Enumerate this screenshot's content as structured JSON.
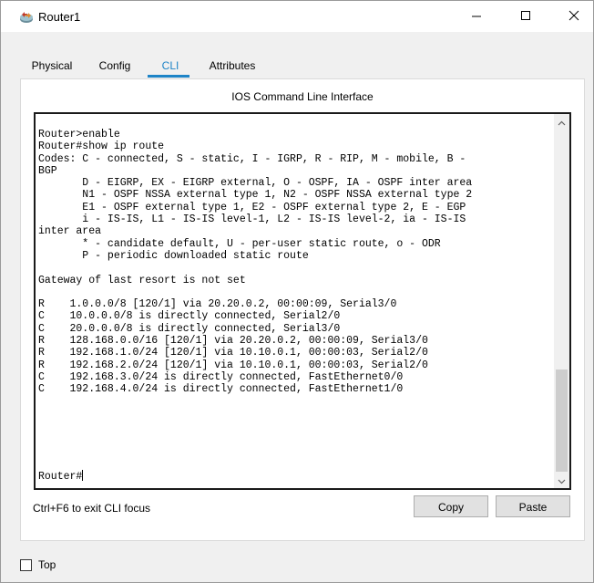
{
  "window": {
    "title": "Router1",
    "minimize_icon": "minimize-icon",
    "maximize_icon": "maximize-icon",
    "close_icon": "close-icon"
  },
  "tabs": [
    {
      "label": "Physical",
      "active": false
    },
    {
      "label": "Config",
      "active": false
    },
    {
      "label": "CLI",
      "active": true
    },
    {
      "label": "Attributes",
      "active": false
    }
  ],
  "cli": {
    "heading": "IOS Command Line Interface",
    "output": "Router>enable\nRouter#show ip route\nCodes: C - connected, S - static, I - IGRP, R - RIP, M - mobile, B -\nBGP\n       D - EIGRP, EX - EIGRP external, O - OSPF, IA - OSPF inter area\n       N1 - OSPF NSSA external type 1, N2 - OSPF NSSA external type 2\n       E1 - OSPF external type 1, E2 - OSPF external type 2, E - EGP\n       i - IS-IS, L1 - IS-IS level-1, L2 - IS-IS level-2, ia - IS-IS\ninter area\n       * - candidate default, U - per-user static route, o - ODR\n       P - periodic downloaded static route\n\nGateway of last resort is not set\n\nR    1.0.0.0/8 [120/1] via 20.20.0.2, 00:00:09, Serial3/0\nC    10.0.0.0/8 is directly connected, Serial2/0\nC    20.0.0.0/8 is directly connected, Serial3/0\nR    128.168.0.0/16 [120/1] via 20.20.0.2, 00:00:09, Serial3/0\nR    192.168.1.0/24 [120/1] via 10.10.0.1, 00:00:03, Serial2/0\nR    192.168.2.0/24 [120/1] via 10.10.0.1, 00:00:03, Serial2/0\nC    192.168.3.0/24 is directly connected, FastEthernet0/0\nC    192.168.4.0/24 is directly connected, FastEthernet1/0",
    "prompt": "Router#"
  },
  "footer": {
    "hint": "Ctrl+F6 to exit CLI focus",
    "copy_label": "Copy",
    "paste_label": "Paste"
  },
  "bottom": {
    "top_label": "Top",
    "top_checked": false
  },
  "colors": {
    "accent": "#1e84c7",
    "button_bg": "#e1e1e1",
    "window_bg": "#f0f0f0"
  }
}
